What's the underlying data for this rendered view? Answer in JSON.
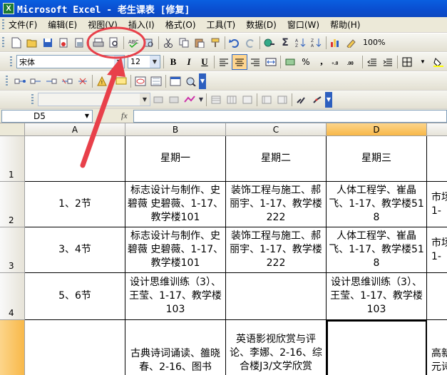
{
  "window": {
    "title": "Microsoft Excel - 老生课表  [修复]"
  },
  "menu": [
    "文件(F)",
    "编辑(E)",
    "视图(V)",
    "插入(I)",
    "格式(O)",
    "工具(T)",
    "数据(D)",
    "窗口(W)",
    "帮助(H)"
  ],
  "toolbar": {
    "zoom": "100%",
    "font_name": "宋体",
    "font_size": "12",
    "bold": "B",
    "italic": "I",
    "underline": "U",
    "sigma": "Σ",
    "percent": "%"
  },
  "formula_bar": {
    "name_box": "D5",
    "fx": "fx",
    "content": ""
  },
  "columns": [
    "A",
    "B",
    "C",
    "D"
  ],
  "rows": [
    "1",
    "2",
    "3",
    "4",
    ""
  ],
  "cells": {
    "r1": [
      "",
      "星期一",
      "星期二",
      "星期三",
      ""
    ],
    "r2": [
      "1、2节",
      "标志设计与制作、史碧薇  史碧薇、1-17、教学楼101",
      "装饰工程与施工、郝丽宇、1-17、教学楼222",
      "人体工程学、崔晶飞、1-17、教学楼518",
      "市场\n1-"
    ],
    "r3": [
      "3、4节",
      "标志设计与制作、史碧薇  史碧薇、1-17、教学楼101",
      "装饰工程与施工、郝丽宇、1-17、教学楼222",
      "人体工程学、崔晶飞、1-17、教学楼518",
      "市场\n1-"
    ],
    "r4": [
      "5、6节",
      "设计思维训练（3）、王莹、1-17、教学楼103",
      "",
      "设计思维训练（3）、王莹、1-17、教学楼103",
      ""
    ],
    "r5": [
      "",
      "古典诗词诵读、雒晓春、2-16、图书",
      "英语影视欣赏与评论、李娜、2-16、综合楼J3/文学欣赏",
      "",
      "高新\n元诗"
    ]
  },
  "colors": {
    "titlebar": "#0a55d8",
    "selected_header": "#f8b849",
    "annotation": "#e8404a"
  }
}
